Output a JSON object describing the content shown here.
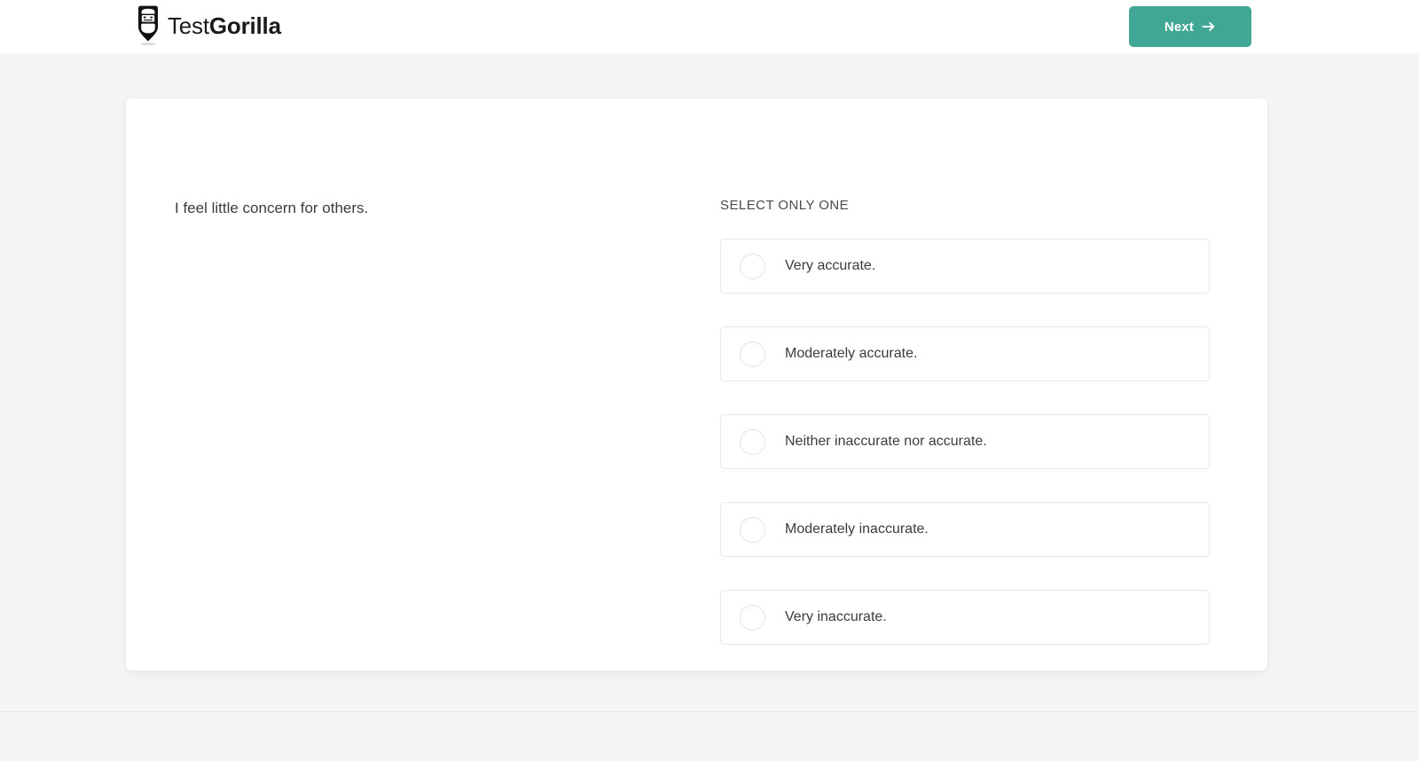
{
  "header": {
    "logo_icon": "gorilla-face-icon",
    "brand_light": "Test",
    "brand_bold": "Gorilla",
    "next_label": "Next",
    "next_icon": "arrow-right-icon",
    "accent_color": "#40a794"
  },
  "question": {
    "prompt": "I feel little concern for others.",
    "select_hint": "SELECT ONLY ONE",
    "options": [
      {
        "label": "Very accurate.",
        "selected": false
      },
      {
        "label": "Moderately accurate.",
        "selected": false
      },
      {
        "label": "Neither inaccurate nor accurate.",
        "selected": false
      },
      {
        "label": "Moderately inaccurate.",
        "selected": false
      },
      {
        "label": "Very inaccurate.",
        "selected": false
      }
    ]
  },
  "colors": {
    "page_background": "#f5f5f5",
    "card_background": "#ffffff",
    "card_border": "#e8e8e8",
    "text": "#3c3c3c",
    "divider": "#e6e6e6"
  }
}
